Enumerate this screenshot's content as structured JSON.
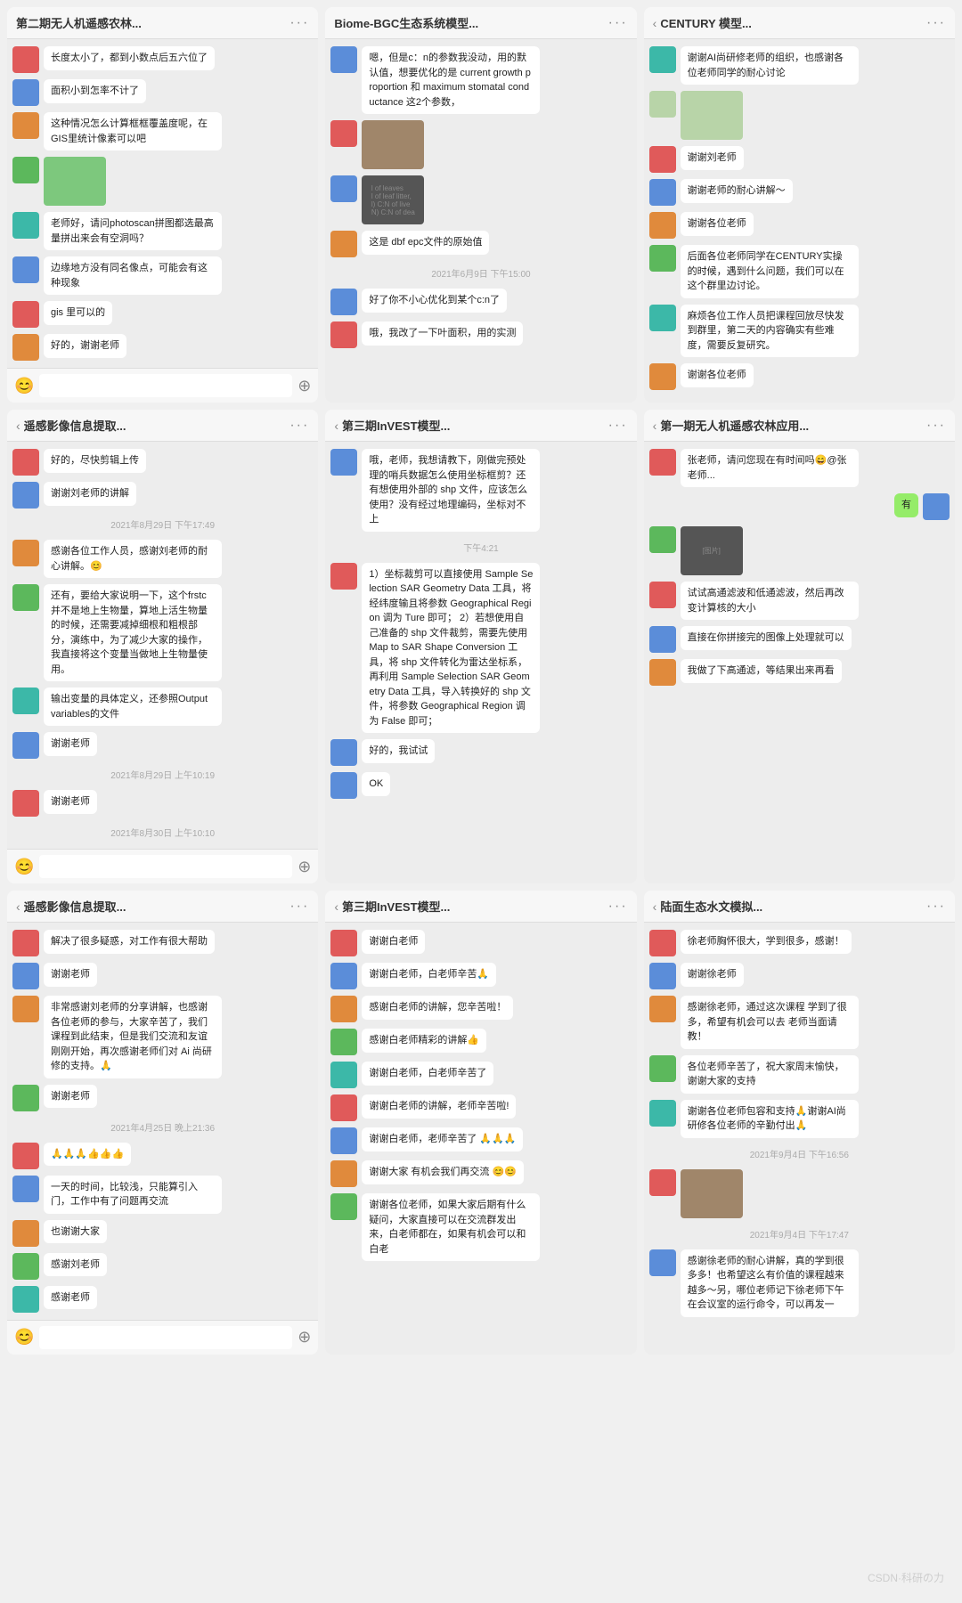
{
  "watermark": "CSDN·科研の力",
  "windows": [
    {
      "id": "win1",
      "title": "第二期无人机遥感农林...",
      "hasBack": false,
      "messages": [
        {
          "avatar": "red",
          "side": "left",
          "text": "长度太小了，都到小数点后五六位了"
        },
        {
          "avatar": "blue",
          "side": "left",
          "text": "面积小到怎率不计了"
        },
        {
          "avatar": "orange",
          "side": "left",
          "text": "这种情况怎么计算框框覆盖度呢，在GIS里统计像素可以吧"
        },
        {
          "avatar": "green",
          "side": "left",
          "isImg": true,
          "imgClass": "green-img"
        },
        {
          "avatar": "teal",
          "side": "left",
          "text": "老师好，请问photoscan拼图都选最高量拼出来会有空洞吗？"
        },
        {
          "avatar": "blue",
          "side": "left",
          "text": "边缘地方没有同名像点，可能会有这种现象"
        },
        {
          "avatar": "red",
          "side": "left",
          "text": "gis 里可以的"
        },
        {
          "avatar": "orange",
          "side": "left",
          "text": "好的，谢谢老师"
        }
      ],
      "hasFooter": true
    },
    {
      "id": "win2",
      "title": "Biome-BGC生态系统模型...",
      "hasBack": false,
      "messages": [
        {
          "avatar": "blue",
          "side": "left",
          "text": "嗯，但是c：n的参数我没动，用的默认值，想要优化的是 current growth proportion 和 maximum stomatal conductance 这2个参数，"
        },
        {
          "avatar": "red",
          "side": "left",
          "isImg": true,
          "imgClass": "brown-img"
        },
        {
          "avatar": "blue",
          "side": "left",
          "isImg": true,
          "imgClass": "dark-img",
          "imgText": "l of leaves\nl of leaf litter,\nl) C:N of live \nN) C:N of dea"
        },
        {
          "avatar": "orange",
          "side": "left",
          "text": "这是 dbf epc文件的原始值"
        },
        {
          "timestamp": "2021年6月9日 下午15:00"
        },
        {
          "avatar": "blue",
          "side": "left",
          "text": "好了你不小心优化到某个c:n了"
        },
        {
          "avatar": "red",
          "side": "left",
          "text": "哦，我改了一下叶面积，用的实测"
        }
      ],
      "hasFooter": false
    },
    {
      "id": "win3",
      "title": "CENTURY 模型...",
      "hasBack": true,
      "messages": [
        {
          "avatar": "teal",
          "side": "left",
          "text": "谢谢AI尚研修老师的组织，也感谢各位老师同学的耐心讨论"
        },
        {
          "avatar": "map",
          "side": "left",
          "isImg": true,
          "imgClass": "map-img"
        },
        {
          "avatar": "red",
          "side": "left",
          "text": "谢谢刘老师"
        },
        {
          "avatar": "blue",
          "side": "left",
          "text": "谢谢老师的耐心讲解～"
        },
        {
          "avatar": "orange",
          "side": "left",
          "text": "谢谢各位老师"
        },
        {
          "avatar": "green",
          "side": "left",
          "text": "后面各位老师同学在CENTURY实操的时候，遇到什么问题，我们可以在这个群里边讨论。"
        },
        {
          "avatar": "teal",
          "side": "left",
          "text": "麻烦各位工作人员把课程回放尽快发到群里，第二天的内容确实有些难度，需要反复研究。"
        },
        {
          "avatar": "orange",
          "side": "left",
          "text": "谢谢各位老师"
        }
      ],
      "hasFooter": false
    },
    {
      "id": "win4",
      "title": "遥感影像信息提取...",
      "hasBack": true,
      "messages": [
        {
          "avatar": "red",
          "side": "left",
          "text": "好的，尽快剪辑上传"
        },
        {
          "avatar": "blue",
          "side": "left",
          "text": "谢谢刘老师的讲解"
        },
        {
          "timestamp": "2021年8月29日 下午17:49"
        },
        {
          "avatar": "orange",
          "side": "left",
          "text": "感谢各位工作人员，感谢刘老师的耐心讲解。😊"
        },
        {
          "avatar": "green",
          "side": "left",
          "text": "还有，要给大家说明一下，这个frstc并不是地上生物量，算地上活生物量的时候，还需要减掉细根和粗根部分，演练中，为了减少大家的操作，我直接将这个变量当做地上生物量使用。"
        },
        {
          "avatar": "teal",
          "side": "left",
          "text": "输出变量的具体定义，还参照Output variables的文件"
        },
        {
          "avatar": "blue",
          "side": "left",
          "text": "谢谢老师"
        },
        {
          "timestamp": "2021年8月29日 上午10:19"
        },
        {
          "avatar": "red",
          "side": "left",
          "text": "谢谢老师"
        },
        {
          "timestamp": "2021年8月30日 上午10:10"
        }
      ],
      "hasFooter": true
    },
    {
      "id": "win5",
      "title": "第三期InVEST模型...",
      "hasBack": true,
      "messages": [
        {
          "avatar": "blue",
          "side": "left",
          "text": "哦，老师，我想请教下，刚做完预处理的哨兵数据怎么使用坐标框剪？还有想使用外部的 shp 文件，应该怎么使用？没有经过地理编码，坐标对不上"
        },
        {
          "timestamp": "下午4:21"
        },
        {
          "avatar": "red",
          "side": "left",
          "text": "1）坐标裁剪可以直接使用 Sample Selection SAR Geometry Data 工具，将经纬度输且将参数 Geographical Region 调为 Ture 即可；\n2）若想使用自己准备的 shp 文件裁剪，需要先使用 Map to SAR Shape Conversion 工具，将 shp 文件转化为雷达坐标系，再利用 Sample Selection SAR Geometry Data 工具，导入转换好的 shp 文件，将参数 Geographical Region 调为 False 即可；"
        },
        {
          "avatar": "blue",
          "side": "left",
          "text": "好的，我试试"
        },
        {
          "avatar": "blue",
          "side": "left",
          "text": "OK"
        }
      ],
      "hasFooter": false
    },
    {
      "id": "win6",
      "title": "第一期无人机遥感农林应用...",
      "hasBack": true,
      "messages": [
        {
          "avatar": "red",
          "side": "left",
          "text": "张老师，请问您现在有时间吗😄@张老师..."
        },
        {
          "avatar": "blue",
          "side": "right",
          "text": "有",
          "isRight": true
        },
        {
          "avatar": "green",
          "side": "left",
          "isImg": true,
          "imgClass": "dark-img",
          "imgText": "[图片]"
        },
        {
          "avatar": "red",
          "side": "left",
          "text": "试试高通滤波和低通滤波，然后再改变计算核的大小"
        },
        {
          "avatar": "blue",
          "side": "left",
          "text": "直接在你拼接完的图像上处理就可以"
        },
        {
          "avatar": "orange",
          "side": "left",
          "text": "我做了下高通滤，等结果出来再看"
        }
      ],
      "hasFooter": false
    },
    {
      "id": "win7",
      "title": "遥感影像信息提取...",
      "hasBack": true,
      "messages": [
        {
          "avatar": "red",
          "side": "left",
          "text": "解决了很多疑惑，对工作有很大帮助"
        },
        {
          "avatar": "blue",
          "side": "left",
          "text": "谢谢老师"
        },
        {
          "avatar": "orange",
          "side": "left",
          "text": "非常感谢刘老师的分享讲解，也感谢各位老师的参与，大家辛苦了，我们课程到此结束，但是我们交流和友谊刚刚开始，再次感谢老师们对 Ai 尚研修的支持。🙏"
        },
        {
          "avatar": "green",
          "side": "left",
          "text": "谢谢老师"
        },
        {
          "timestamp": "2021年4月25日 晚上21:36"
        },
        {
          "avatar": "red",
          "side": "left",
          "text": "🙏🙏🙏👍👍👍"
        },
        {
          "avatar": "blue",
          "side": "left",
          "text": "一天的时间，比较浅，只能算引入门，工作中有了问题再交流"
        },
        {
          "avatar": "orange",
          "side": "left",
          "text": "也谢谢大家"
        },
        {
          "avatar": "green",
          "side": "left",
          "text": "感谢刘老师"
        },
        {
          "avatar": "teal",
          "side": "left",
          "text": "感谢老师"
        }
      ],
      "hasFooter": true
    },
    {
      "id": "win8",
      "title": "第三期InVEST模型...",
      "hasBack": true,
      "messages": [
        {
          "avatar": "red",
          "side": "left",
          "text": "谢谢白老师"
        },
        {
          "avatar": "blue",
          "side": "left",
          "text": "谢谢白老师，白老师辛苦🙏"
        },
        {
          "avatar": "orange",
          "side": "left",
          "text": "感谢白老师的讲解，您辛苦啦！"
        },
        {
          "avatar": "green",
          "side": "left",
          "text": "感谢白老师精彩的讲解👍"
        },
        {
          "avatar": "teal",
          "side": "left",
          "text": "谢谢白老师，白老师辛苦了"
        },
        {
          "avatar": "red",
          "side": "left",
          "text": "谢谢白老师的讲解，老师辛苦啦!"
        },
        {
          "avatar": "blue",
          "side": "left",
          "text": "谢谢白老师，老师辛苦了 🙏🙏🙏"
        },
        {
          "avatar": "orange",
          "side": "left",
          "text": "谢谢大家 有机会我们再交流 😊😊"
        },
        {
          "avatar": "green",
          "side": "left",
          "text": "谢谢各位老师，如果大家后期有什么疑问，大家直接可以在交流群发出来，白老师都在，如果有机会可以和白老"
        }
      ],
      "hasFooter": false
    },
    {
      "id": "win9",
      "title": "陆面生态水文模拟...",
      "hasBack": true,
      "messages": [
        {
          "avatar": "red",
          "side": "left",
          "text": "徐老师胸怀很大，学到很多，感谢！"
        },
        {
          "avatar": "blue",
          "side": "left",
          "text": "谢谢徐老师"
        },
        {
          "avatar": "orange",
          "side": "left",
          "text": "感谢徐老师，通过这次课程 学到了很多，希望有机会可以去 老师当面请教！"
        },
        {
          "avatar": "green",
          "side": "left",
          "text": "各位老师辛苦了，祝大家周末愉快，谢谢大家的支持"
        },
        {
          "avatar": "teal",
          "side": "left",
          "text": "谢谢各位老师包容和支持🙏谢谢AI尚研修各位老师的辛勤付出🙏"
        },
        {
          "timestamp": "2021年9月4日 下午16:56"
        },
        {
          "avatar": "red",
          "side": "left",
          "isImg": true,
          "imgClass": "brown-img"
        },
        {
          "timestamp": "2021年9月4日 下午17:47"
        },
        {
          "avatar": "blue",
          "side": "left",
          "text": "感谢徐老师的耐心讲解，真的学到很多多！也希望这么有价值的课程越来越多～另，哪位老师记下徐老师下午在会议室的运行命令，可以再发一"
        }
      ],
      "hasFooter": false
    }
  ]
}
